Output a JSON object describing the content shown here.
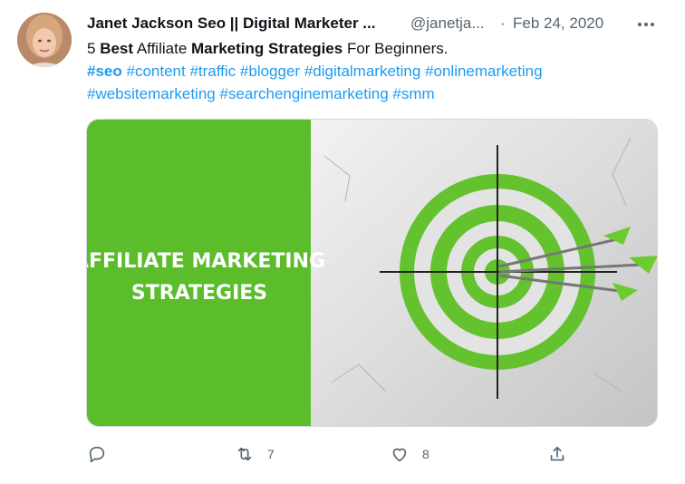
{
  "tweet": {
    "display_name": "Janet Jackson Seo || Digital Marketer ...",
    "handle": "@janetja...",
    "separator": "·",
    "date": "Feb 24, 2020",
    "text": {
      "prefix": "5 ",
      "bold1": "Best",
      "mid1": " Affiliate ",
      "bold2": "Marketing Strategies",
      "suffix": " For Beginners."
    },
    "hashtags": [
      "#seo",
      "#content",
      "#traffic",
      "#blogger",
      "#digitalmarketing",
      "#onlinemarketing",
      "#websitemarketing",
      "#searchenginemarketing",
      "#smm"
    ],
    "image": {
      "line1": "AFFILIATE MARKETING",
      "line2": "STRATEGIES"
    },
    "actions": {
      "reply_icon": "reply-icon",
      "retweet_icon": "retweet-icon",
      "retweet_count": "7",
      "like_icon": "heart-icon",
      "like_count": "8",
      "share_icon": "share-icon"
    },
    "colors": {
      "link": "#1d9bf0",
      "muted": "#536471",
      "green": "#5bbd2b"
    }
  }
}
